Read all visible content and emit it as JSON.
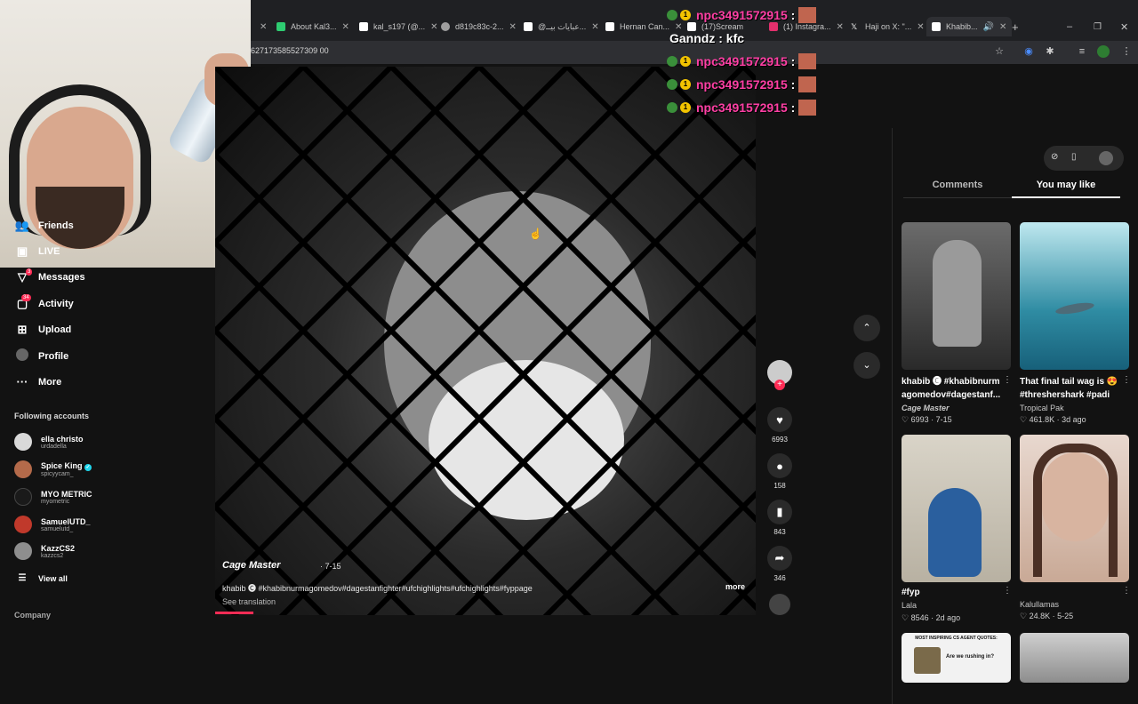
{
  "browser": {
    "tabs": [
      {
        "label": "About Kal3...",
        "favicon_color": "#2ecc71"
      },
      {
        "label": "kal_s197 (@...",
        "favicon_color": "#ffffff"
      },
      {
        "label": "d819c83c-2...",
        "favicon_color": "#9e9e9e"
      },
      {
        "label": "@عبايات بيــ...",
        "favicon_color": "#ffffff"
      },
      {
        "label": "Hernan Can...",
        "favicon_color": "#ffffff"
      },
      {
        "label": "(17)Scream",
        "favicon_color": "#ffffff"
      },
      {
        "label": "(1) Instagra...",
        "favicon_color": "#e1306c"
      },
      {
        "label": "Haji on X: \"...",
        "favicon_color": "#ffffff"
      },
      {
        "label": "Khabib...",
        "favicon_color": "#ffffff"
      }
    ],
    "url": "627173585527309 00"
  },
  "chat_overlay": [
    {
      "user": "npc3491572915",
      "sep": ":"
    },
    {
      "user": "Ganndz",
      "sep": ":",
      "message": "kfc"
    },
    {
      "user": "npc3491572915",
      "sep": ":"
    },
    {
      "user": "npc3491572915",
      "sep": ":"
    },
    {
      "user": "npc3491572915",
      "sep": ":"
    }
  ],
  "chat_badge_number": "1",
  "sidebar": {
    "nav": [
      {
        "label": "Friends",
        "icon": "friends-icon"
      },
      {
        "label": "LIVE",
        "icon": "live-icon"
      },
      {
        "label": "Messages",
        "icon": "messages-icon",
        "badge": "3"
      },
      {
        "label": "Activity",
        "icon": "activity-icon",
        "badge": "34"
      },
      {
        "label": "Upload",
        "icon": "upload-icon"
      },
      {
        "label": "Profile",
        "icon": "profile-icon"
      },
      {
        "label": "More",
        "icon": "more-icon"
      }
    ],
    "following_title": "Following accounts",
    "accounts": [
      {
        "name": "ella christo",
        "handle": "urdadella",
        "avatar_color": "#d9d9d9"
      },
      {
        "name": "Spice King",
        "handle": "spicyycam_",
        "avatar_color": "#b46a4a",
        "verified": true
      },
      {
        "name": "MYO METRIC",
        "handle": "myometric",
        "avatar_color": "#1a1a1a"
      },
      {
        "name": "SamuelUTD_",
        "handle": "samuelutd_",
        "avatar_color": "#c0392b"
      },
      {
        "name": "KazzCS2",
        "handle": "kazzcs2",
        "avatar_color": "#8e8e8e"
      }
    ],
    "view_all": "View all",
    "company": "Company"
  },
  "video": {
    "author": "Cage Master",
    "date": "· 7-15",
    "caption": "khabib 🅒 #khabibnurmagomedov#dagestanfighter#ufchighlights#ufchighlights#fyppage",
    "more": "more",
    "see_translation": "See translation",
    "progress": 0.07
  },
  "actions": {
    "likes": "6993",
    "comments": "158",
    "saves": "843",
    "shares": "346"
  },
  "right_panel": {
    "tabs": [
      "Comments",
      "You may like"
    ],
    "active_tab": "You may like",
    "cards": [
      {
        "title": "khabib 🅒 #khabibnurm agomedov#dagestanf...",
        "author": "Cage Master",
        "likes": "6993",
        "date": "7-15"
      },
      {
        "title": "That final tail wag is 😍 #threshershark #padi",
        "author": "Tropical Pak",
        "likes": "461.8K",
        "date": "3d ago"
      },
      {
        "title": "#fyp",
        "author": "Lala",
        "likes": "8546",
        "date": "2d ago"
      },
      {
        "title": "",
        "author": "Kalullamas",
        "likes": "24.8K",
        "date": "5-25"
      }
    ],
    "bottom_card_text": "MOST INSPIRING CS AGENT QUOTES:",
    "bottom_card_sub": "Are we rushing in?"
  }
}
